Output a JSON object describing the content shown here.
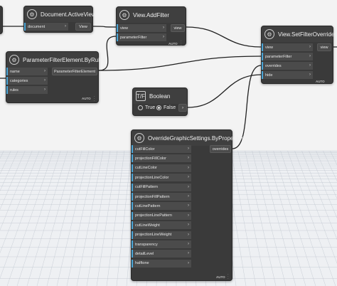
{
  "colors": {
    "node_bg": "#3a3a3a",
    "port_accent": "#4aa5d6",
    "wire": "#202020",
    "grid": "#b9c1cb",
    "canvas": "#f3f3f3"
  },
  "nodes": {
    "active_view": {
      "title": "Document.ActiveView",
      "input": "document",
      "output": "View"
    },
    "add_filter": {
      "title": "View.AddFilter",
      "inputs": [
        "view",
        "parameterFilter"
      ],
      "output": "view",
      "auto": "AUTO"
    },
    "set_filter_overrides": {
      "title": "View.SetFilterOverrides",
      "inputs": [
        "view",
        "parameterFilter",
        "overrides",
        "hide"
      ],
      "output": "view",
      "auto": "AUTO"
    },
    "param_filter": {
      "title": "ParameterFilterElement.ByRules",
      "inputs": [
        "name",
        "categories",
        "rules"
      ],
      "output": "ParameterFilterElement",
      "auto": "AUTO"
    },
    "boolean": {
      "title": "Boolean",
      "true_label": "True",
      "false_label": "False",
      "selected": "False"
    },
    "ogs": {
      "title": "OverrideGraphicSettings.ByProperties",
      "inputs": [
        "cutFillColor",
        "projectionFillColor",
        "cutLineColor",
        "projectionLineColor",
        "cutFillPattern",
        "projectionFillPattern",
        "cutLinePattern",
        "projectionLinePattern",
        "cutLineWeight",
        "projectionLineWeight",
        "transparency",
        "detailLevel",
        "halftone"
      ],
      "output": "overrides",
      "auto": "AUTO"
    }
  },
  "icons": {
    "node": "node-gear-icon",
    "arrow": "chevron-right-icon",
    "menu": "vertical-dots-icon"
  }
}
